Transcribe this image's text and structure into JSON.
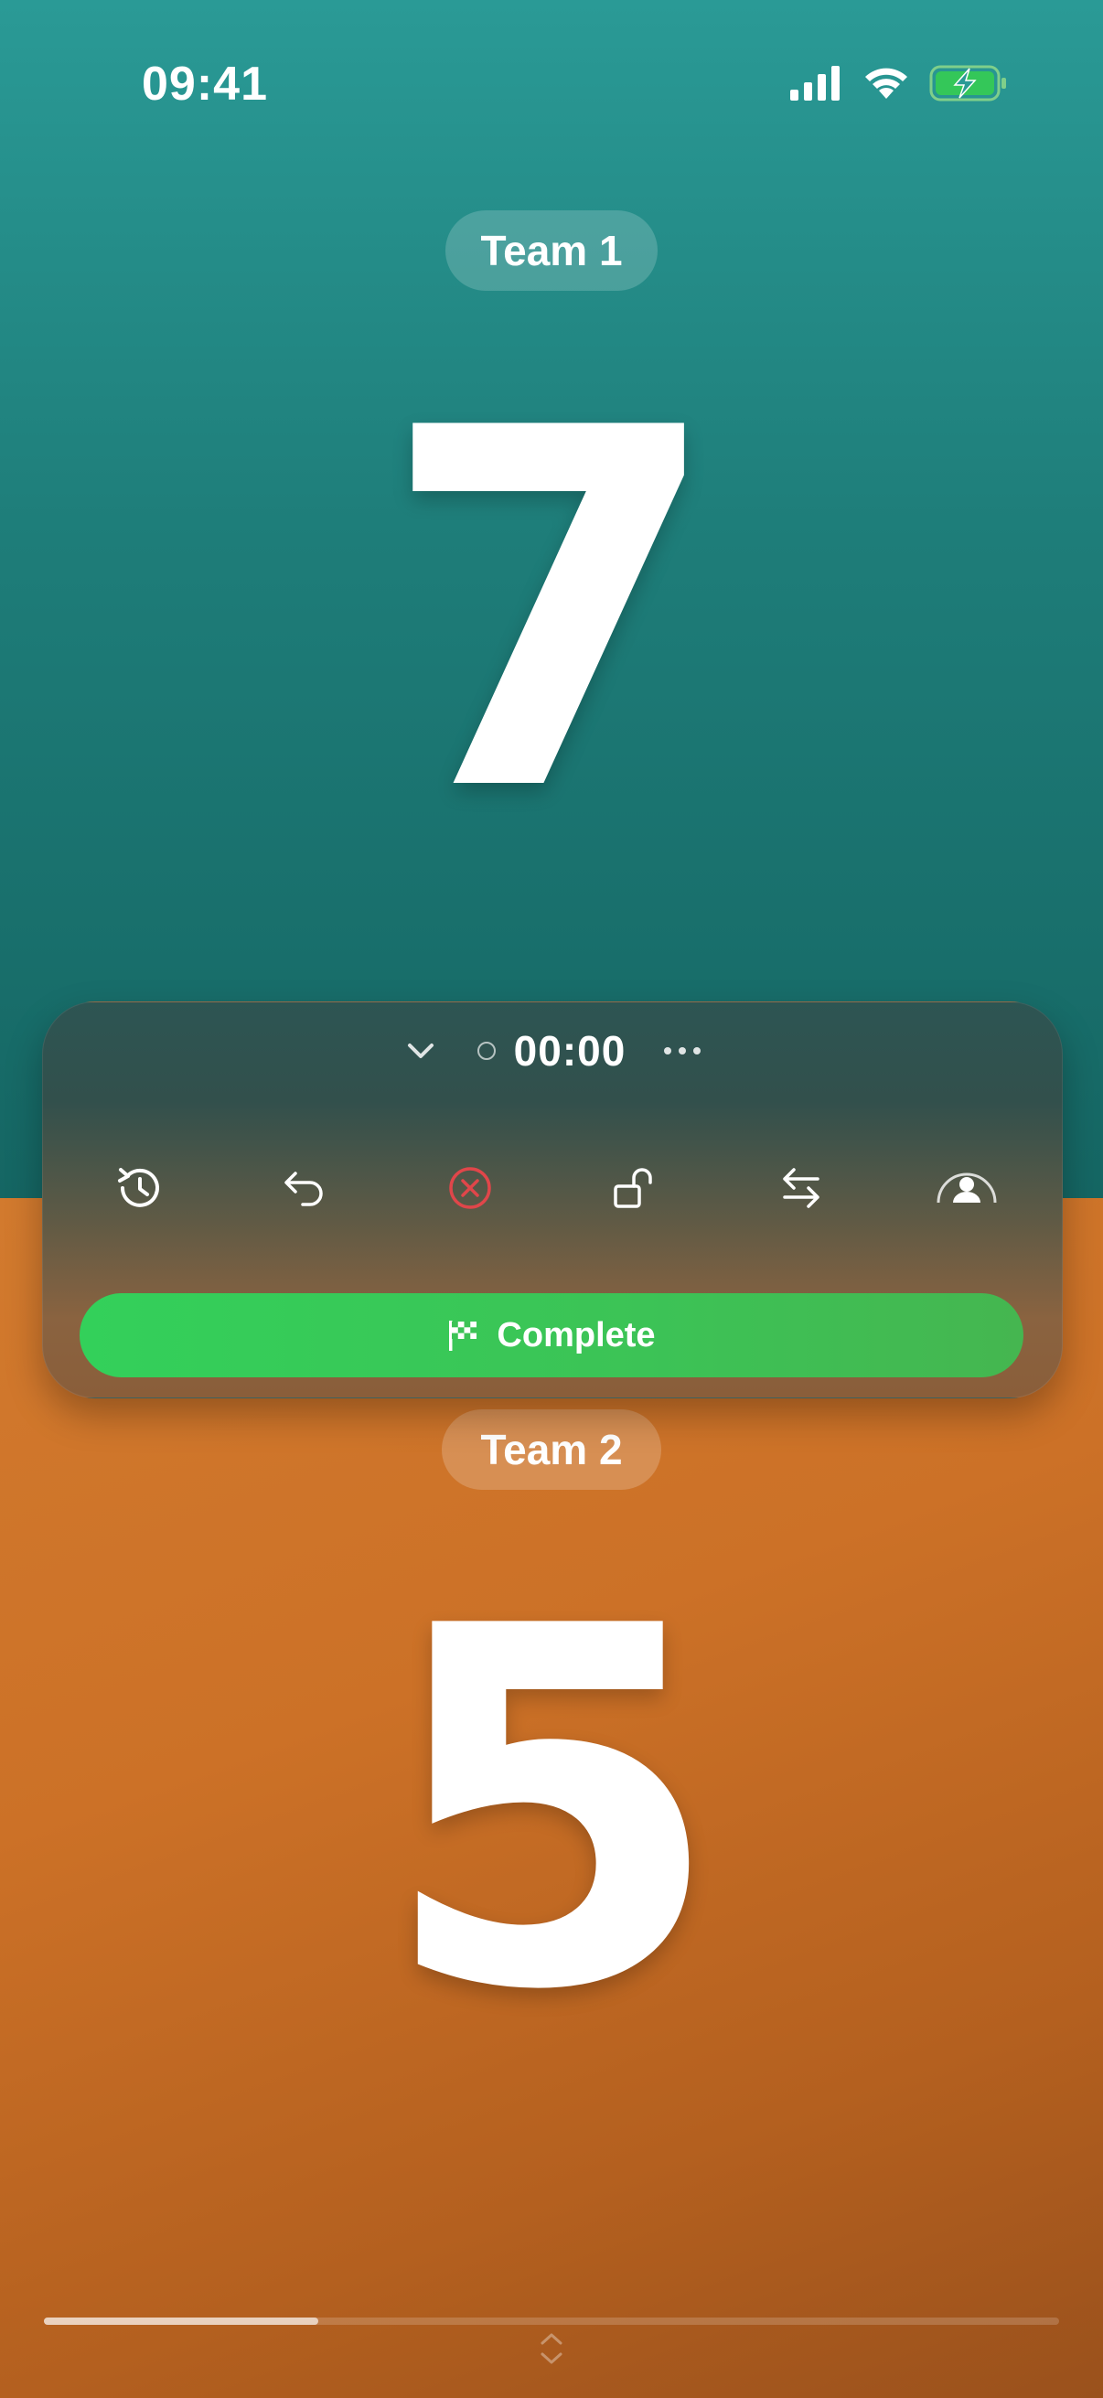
{
  "status_bar": {
    "time": "09:41",
    "icons": [
      "cellular-signal-icon",
      "wifi-icon",
      "battery-charging-icon"
    ]
  },
  "team1": {
    "name": "Team 1",
    "score": "7",
    "color": "#1e7d79"
  },
  "team2": {
    "name": "Team 2",
    "score": "5",
    "color": "#cc7127"
  },
  "panel": {
    "timer": "00:00",
    "collapse_icon": "chevron-down-icon",
    "more_icon": "more-horizontal-icon",
    "actions": [
      {
        "name": "history",
        "icon": "history-icon"
      },
      {
        "name": "undo",
        "icon": "undo-icon"
      },
      {
        "name": "reset",
        "icon": "close-circle-icon",
        "color": "#e0464a"
      },
      {
        "name": "lock",
        "icon": "unlock-icon"
      },
      {
        "name": "swap",
        "icon": "swap-icon"
      },
      {
        "name": "player",
        "icon": "person-badge-icon"
      }
    ],
    "complete_label": "Complete",
    "complete_color": "#34c759"
  },
  "progress": {
    "fraction": 0.27
  }
}
